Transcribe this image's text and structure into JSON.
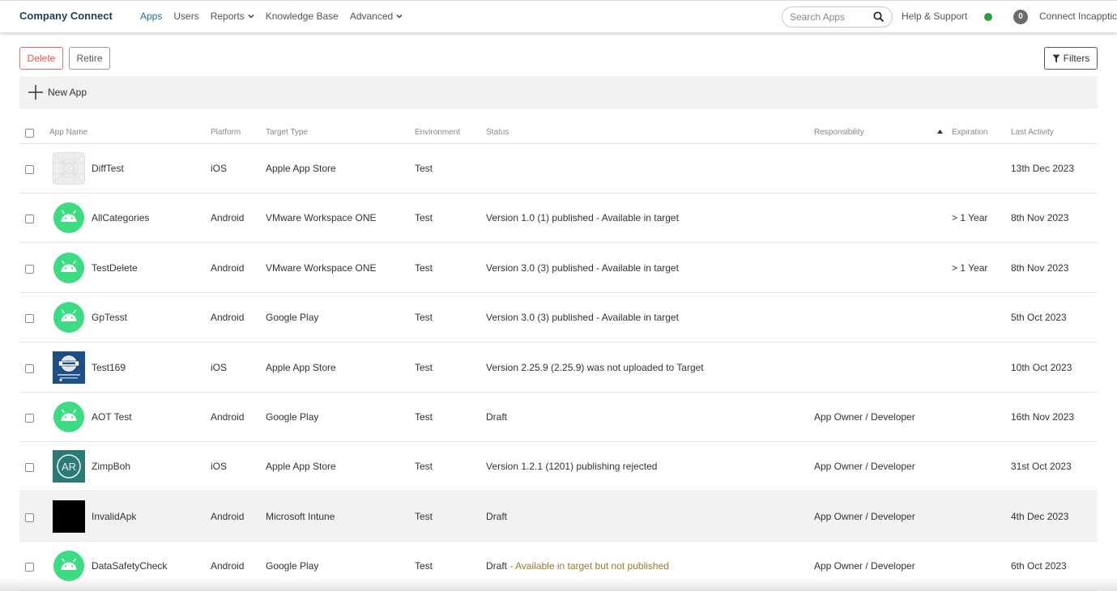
{
  "header": {
    "brand": "Company Connect",
    "nav": [
      {
        "label": "Apps",
        "active": true,
        "dropdown": false
      },
      {
        "label": "Users",
        "active": false,
        "dropdown": false
      },
      {
        "label": "Reports",
        "active": false,
        "dropdown": true
      },
      {
        "label": "Knowledge Base",
        "active": false,
        "dropdown": false
      },
      {
        "label": "Advanced",
        "active": false,
        "dropdown": true
      }
    ],
    "search_placeholder": "Search Apps",
    "help_label": "Help & Support",
    "status_color": "#2e9e3d",
    "notification_count": "0",
    "user_label": "Connect Incapptic"
  },
  "toolbar": {
    "delete_label": "Delete",
    "retire_label": "Retire",
    "filters_label": "Filters"
  },
  "new_app_label": "New App",
  "table": {
    "columns": {
      "app_name": "App Name",
      "platform": "Platform",
      "target_type": "Target Type",
      "environment": "Environment",
      "status": "Status",
      "responsibility": "Responsibility",
      "expiration": "Expiration",
      "last_activity": "Last Activity"
    },
    "rows": [
      {
        "name": "DiffTest",
        "icon": "placeholder-grid-icon",
        "platform": "iOS",
        "target": "Apple App Store",
        "env": "Test",
        "status": "",
        "status_warn": "",
        "responsibility": "",
        "expiration": "",
        "last_activity": "13th Dec 2023"
      },
      {
        "name": "AllCategories",
        "icon": "android-icon",
        "platform": "Android",
        "target": "VMware Workspace ONE",
        "env": "Test",
        "status": "Version 1.0 (1) published - Available in target",
        "status_warn": "",
        "responsibility": "",
        "expiration": "> 1 Year",
        "last_activity": "8th Nov 2023"
      },
      {
        "name": "TestDelete",
        "icon": "android-icon",
        "platform": "Android",
        "target": "VMware Workspace ONE",
        "env": "Test",
        "status": "Version 3.0 (3) published - Available in target",
        "status_warn": "",
        "responsibility": "",
        "expiration": "> 1 Year",
        "last_activity": "8th Nov 2023"
      },
      {
        "name": "GpTesst",
        "icon": "android-icon",
        "platform": "Android",
        "target": "Google Play",
        "env": "Test",
        "status": "Version 3.0 (3) published - Available in target",
        "status_warn": "",
        "responsibility": "",
        "expiration": "",
        "last_activity": "5th Oct 2023"
      },
      {
        "name": "Test169",
        "icon": "virtual-badge-icon",
        "platform": "iOS",
        "target": "Apple App Store",
        "env": "Test",
        "status": "Version 2.25.9 (2.25.9) was not uploaded to Target",
        "status_warn": "",
        "responsibility": "",
        "expiration": "",
        "last_activity": "10th Oct 2023"
      },
      {
        "name": "AOT Test",
        "icon": "android-icon",
        "platform": "Android",
        "target": "Google Play",
        "env": "Test",
        "status": "Draft",
        "status_warn": "",
        "responsibility": "App Owner / Developer",
        "expiration": "",
        "last_activity": "16th Nov 2023"
      },
      {
        "name": "ZimpBoh",
        "icon": "ar-icon",
        "platform": "iOS",
        "target": "Apple App Store",
        "env": "Test",
        "status": "Version 1.2.1 (1201) publishing rejected",
        "status_warn": "",
        "responsibility": "App Owner / Developer",
        "expiration": "",
        "last_activity": "31st Oct 2023"
      },
      {
        "name": "InvalidApk",
        "icon": "black-square-icon",
        "platform": "Android",
        "target": "Microsoft Intune",
        "env": "Test",
        "status": "Draft",
        "status_warn": "",
        "responsibility": "App Owner / Developer",
        "expiration": "",
        "last_activity": "4th Dec 2023",
        "highlighted": true
      },
      {
        "name": "DataSafetyCheck",
        "icon": "android-icon",
        "platform": "Android",
        "target": "Google Play",
        "env": "Test",
        "status": "Draft",
        "status_warn": " - Available in target but not published",
        "responsibility": "App Owner / Developer",
        "expiration": "",
        "last_activity": "6th Oct 2023"
      }
    ]
  },
  "colors": {
    "brand": "#1e3d5c",
    "active_nav": "#1a6ea8",
    "delete": "#e05555",
    "android": "#3ddc84",
    "warning_text": "#9a7a2b"
  }
}
